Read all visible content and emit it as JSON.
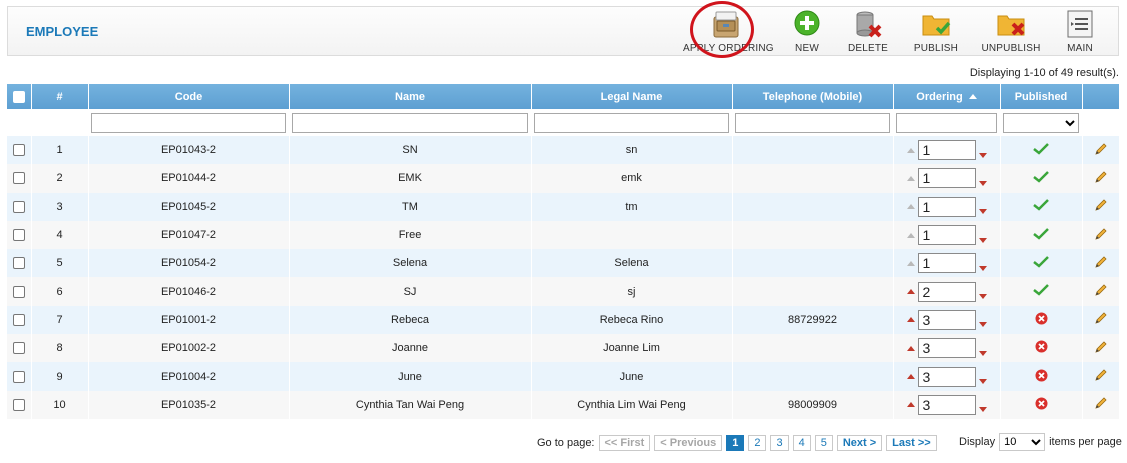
{
  "header": {
    "title": "EMPLOYEE",
    "toolbar": [
      {
        "key": "apply_ordering",
        "label": "APPLY ORDERING",
        "icon": "filing-cabinet-icon"
      },
      {
        "key": "new",
        "label": "NEW",
        "icon": "plus-circle-icon"
      },
      {
        "key": "delete",
        "label": "DELETE",
        "icon": "database-delete-icon"
      },
      {
        "key": "publish",
        "label": "PUBLISH",
        "icon": "folder-check-icon"
      },
      {
        "key": "unpublish",
        "label": "UNPUBLISH",
        "icon": "folder-x-icon"
      },
      {
        "key": "main",
        "label": "MAIN",
        "icon": "list-icon"
      }
    ]
  },
  "summary": "Displaying 1-10 of 49 result(s).",
  "table": {
    "columns": [
      "#",
      "Code",
      "Name",
      "Legal Name",
      "Telephone (Mobile)",
      "Ordering",
      "Published"
    ],
    "rows": [
      {
        "n": "1",
        "code": "EP01043-2",
        "name": "SN",
        "legal": "sn",
        "tel": "",
        "ordering": "1",
        "published": true,
        "up_enabled": false
      },
      {
        "n": "2",
        "code": "EP01044-2",
        "name": "EMK",
        "legal": "emk",
        "tel": "",
        "ordering": "1",
        "published": true,
        "up_enabled": false
      },
      {
        "n": "3",
        "code": "EP01045-2",
        "name": "TM",
        "legal": "tm",
        "tel": "",
        "ordering": "1",
        "published": true,
        "up_enabled": false
      },
      {
        "n": "4",
        "code": "EP01047-2",
        "name": "Free",
        "legal": "",
        "tel": "",
        "ordering": "1",
        "published": true,
        "up_enabled": false
      },
      {
        "n": "5",
        "code": "EP01054-2",
        "name": "Selena",
        "legal": "Selena",
        "tel": "",
        "ordering": "1",
        "published": true,
        "up_enabled": false
      },
      {
        "n": "6",
        "code": "EP01046-2",
        "name": "SJ",
        "legal": "sj",
        "tel": "",
        "ordering": "2",
        "published": true,
        "up_enabled": true
      },
      {
        "n": "7",
        "code": "EP01001-2",
        "name": "Rebeca",
        "legal": "Rebeca Rino",
        "tel": "88729922",
        "ordering": "3",
        "published": false,
        "up_enabled": true
      },
      {
        "n": "8",
        "code": "EP01002-2",
        "name": "Joanne",
        "legal": "Joanne Lim",
        "tel": "",
        "ordering": "3",
        "published": false,
        "up_enabled": true
      },
      {
        "n": "9",
        "code": "EP01004-2",
        "name": "June",
        "legal": "June",
        "tel": "",
        "ordering": "3",
        "published": false,
        "up_enabled": true
      },
      {
        "n": "10",
        "code": "EP01035-2",
        "name": "Cynthia Tan Wai Peng",
        "legal": "Cynthia Lim Wai Peng",
        "tel": "98009909",
        "ordering": "3",
        "published": false,
        "up_enabled": true
      }
    ]
  },
  "pager": {
    "goto_label": "Go to page:",
    "first": "<< First",
    "previous": "< Previous",
    "pages": [
      "1",
      "2",
      "3",
      "4",
      "5"
    ],
    "current": "1",
    "next": "Next >",
    "last": "Last >>",
    "display_label": "Display",
    "per_page": "10",
    "items_label": "items per page"
  },
  "colors": {
    "accent": "#1b79b8",
    "header_bg": "#5d9fd2",
    "published": "#3aa63a",
    "unpublished": "#d9302c",
    "highlight_circle": "#d0141c"
  }
}
